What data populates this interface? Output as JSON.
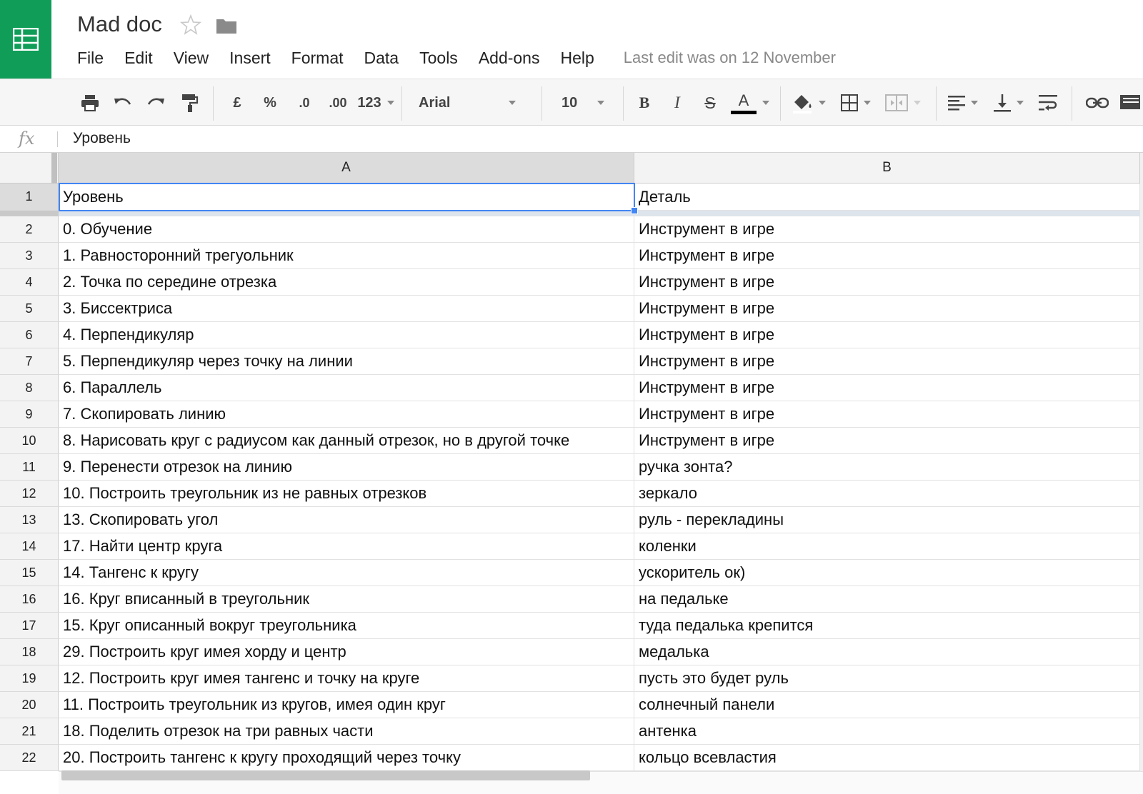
{
  "app": {
    "doc_title": "Mad doc",
    "logo_icon": "sheets-logo-icon",
    "brand_color": "#0f9d58"
  },
  "menu": {
    "items": [
      "File",
      "Edit",
      "View",
      "Insert",
      "Format",
      "Data",
      "Tools",
      "Add-ons",
      "Help"
    ],
    "last_edit": "Last edit was on 12 November"
  },
  "toolbar": {
    "currency": "£",
    "percent": "%",
    "decrease_decimal": ".0",
    "increase_decimal": ".00",
    "more_formats": "123",
    "font": "Arial",
    "font_size": "10",
    "bold": "B",
    "italic": "I",
    "strike": "S",
    "text_color": "A"
  },
  "formula_bar": {
    "fx": "fx",
    "value": "Уровень"
  },
  "sheet": {
    "columns": [
      "A",
      "B"
    ],
    "selected_cell": "A1",
    "rows": [
      {
        "num": "1",
        "a": "Уровень",
        "b": "Деталь"
      },
      {
        "num": "2",
        "a": "0. Обучение",
        "b": "Инструмент в игре"
      },
      {
        "num": "3",
        "a": "1. Равносторонний трегуольник",
        "b": "Инструмент в игре"
      },
      {
        "num": "4",
        "a": "2. Точка по середине отрезка",
        "b": "Инструмент в игре"
      },
      {
        "num": "5",
        "a": "3. Биссектриса",
        "b": "Инструмент в игре"
      },
      {
        "num": "6",
        "a": "4. Перпендикуляр",
        "b": "Инструмент в игре"
      },
      {
        "num": "7",
        "a": "5. Перпендикуляр через точку на линии",
        "b": "Инструмент в игре"
      },
      {
        "num": "8",
        "a": "6. Параллель",
        "b": "Инструмент в игре"
      },
      {
        "num": "9",
        "a": "7. Скопировать линию",
        "b": "Инструмент в игре"
      },
      {
        "num": "10",
        "a": "8. Нарисовать круг с радиусом как данный отрезок, но в другой точке",
        "b": "Инструмент в игре"
      },
      {
        "num": "11",
        "a": "9. Перенести отрезок на линию",
        "b": "ручка зонта?"
      },
      {
        "num": "12",
        "a": "10. Построить треугольник из не равных отрезков",
        "b": "зеркало"
      },
      {
        "num": "13",
        "a": "13. Скопировать угол",
        "b": "руль - перекладины"
      },
      {
        "num": "14",
        "a": "17. Найти центр круга",
        "b": "коленки"
      },
      {
        "num": "15",
        "a": "14. Тангенс к кругу",
        "b": "ускоритель ок)"
      },
      {
        "num": "16",
        "a": "16. Круг вписанный в треугольник",
        "b": "на педальке"
      },
      {
        "num": "17",
        "a": "15. Круг описанный вокруг треугольника",
        "b": "туда педалька крепится"
      },
      {
        "num": "18",
        "a": "29. Построить круг имея хорду и центр",
        "b": "медалька"
      },
      {
        "num": "19",
        "a": "12. Построить круг имея тангенс и точку на круге",
        "b": "пусть это будет руль"
      },
      {
        "num": "20",
        "a": "11. Построить треугольник из кругов, имея один круг",
        "b": "солнечный панели"
      },
      {
        "num": "21",
        "a": "18. Поделить отрезок на три равных части",
        "b": "антенка"
      },
      {
        "num": "22",
        "a": "20. Построить тангенс к кругу проходящий через точку",
        "b": "кольцо всевластия"
      }
    ]
  }
}
